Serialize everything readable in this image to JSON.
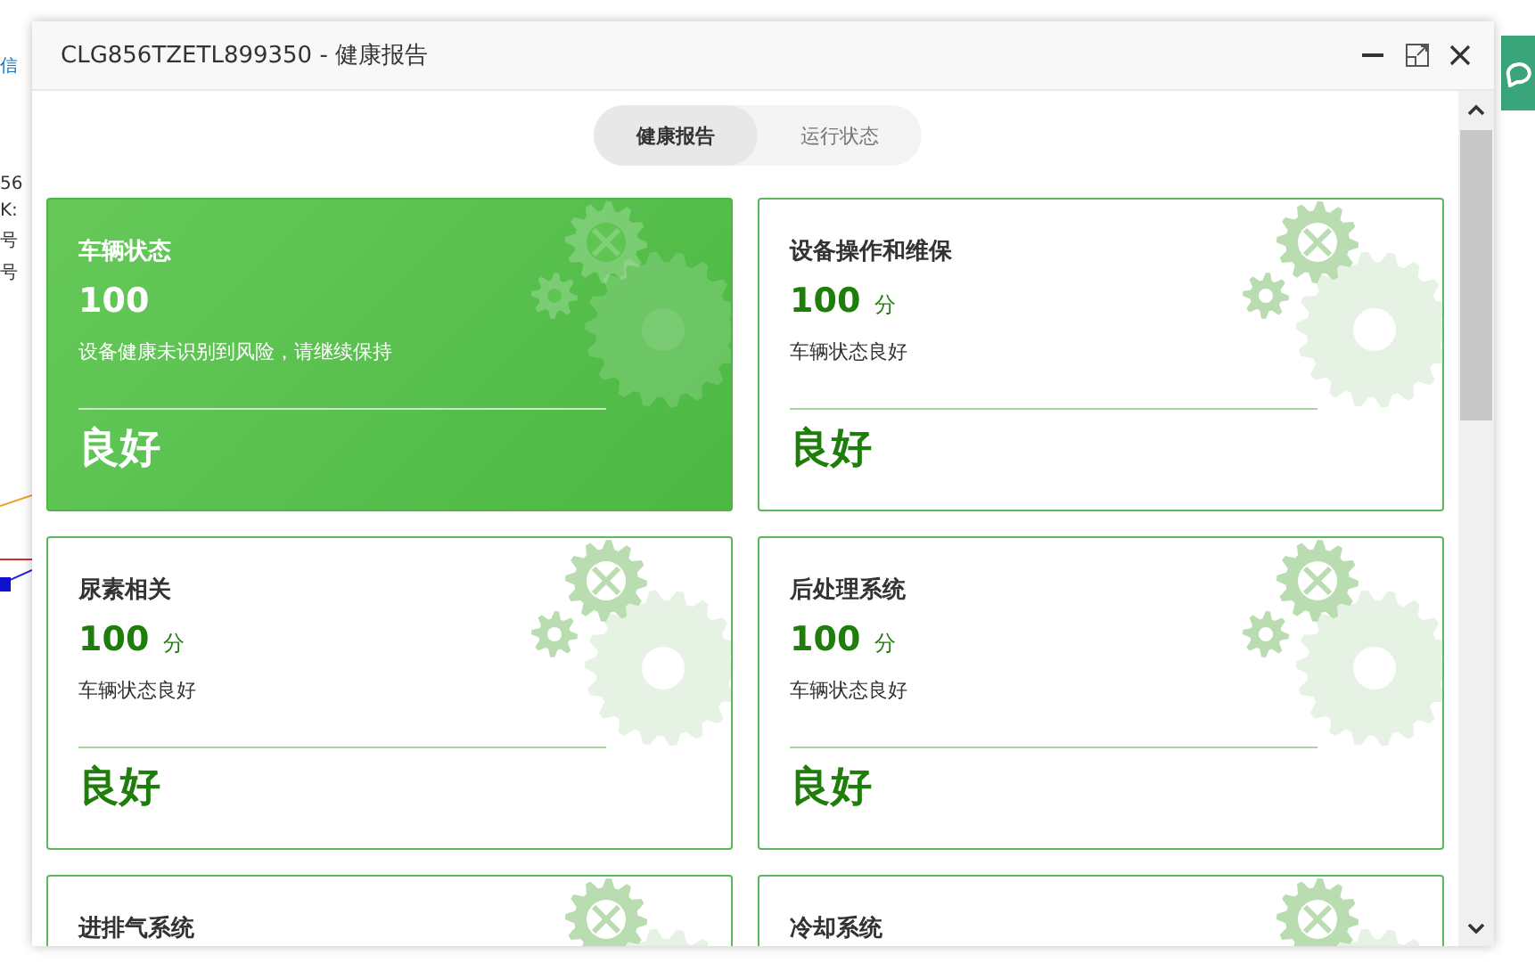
{
  "background": {
    "left_texts": [
      "信",
      "56",
      "K:",
      "号",
      "号"
    ],
    "side_button": {
      "kind": "chat"
    }
  },
  "window": {
    "title": "CLG856TZETL899350 - 健康报告"
  },
  "tabs": [
    {
      "label": "健康报告",
      "selected": true
    },
    {
      "label": "运行状态",
      "selected": false
    }
  ],
  "cards": [
    {
      "kind": "highlight",
      "title": "车辆状态",
      "score": "100",
      "description": "设备健康未识别到风险，请继续保持",
      "grade": "良好"
    },
    {
      "kind": "normal",
      "title": "设备操作和维保",
      "score": "100",
      "unit": "分",
      "description": "车辆状态良好",
      "grade": "良好"
    },
    {
      "kind": "normal",
      "title": "尿素相关",
      "score": "100",
      "unit": "分",
      "description": "车辆状态良好",
      "grade": "良好"
    },
    {
      "kind": "normal",
      "title": "后处理系统",
      "score": "100",
      "unit": "分",
      "description": "车辆状态良好",
      "grade": "良好"
    },
    {
      "kind": "normal",
      "title": "进排气系统"
    },
    {
      "kind": "normal",
      "title": "冷却系统"
    }
  ]
}
